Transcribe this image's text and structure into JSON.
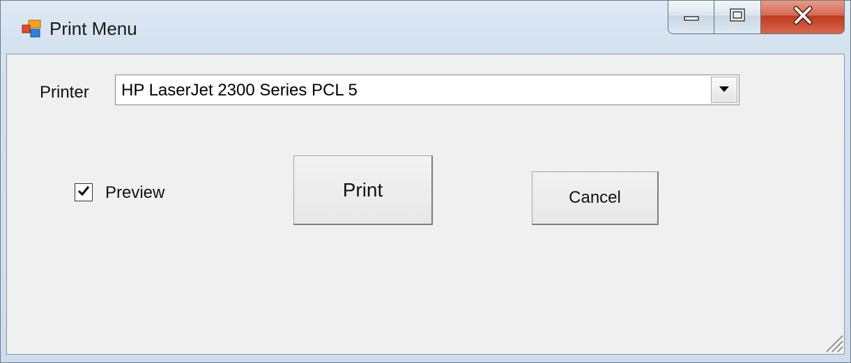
{
  "window": {
    "title": "Print Menu"
  },
  "printer": {
    "label": "Printer",
    "selected": "HP LaserJet 2300 Series PCL 5"
  },
  "preview": {
    "label": "Preview",
    "checked": true
  },
  "buttons": {
    "print_label": "Print",
    "cancel_label": "Cancel"
  },
  "icons": {
    "app": "app-window-icon",
    "minimize": "minimize-icon",
    "maximize": "maximize-icon",
    "close": "close-icon",
    "dropdown": "dropdown-arrow-icon",
    "grip": "resize-grip-icon"
  },
  "colors": {
    "close_button": "#c0391f",
    "client_bg": "#f0f0f0",
    "title_bg": "#d4e1ef"
  }
}
